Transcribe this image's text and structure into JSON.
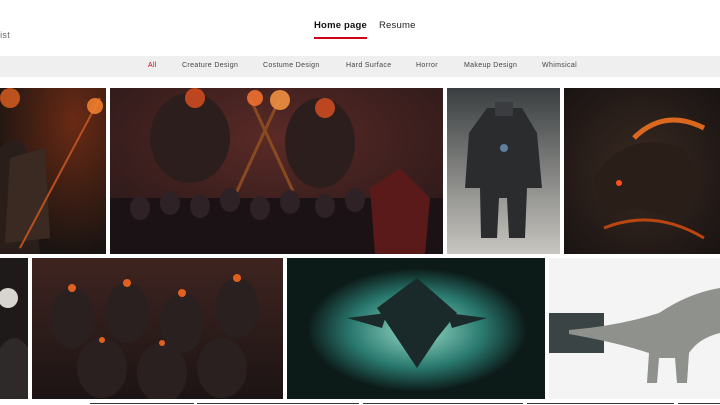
{
  "brand": {
    "subtitle": "rtist"
  },
  "nav": {
    "items": [
      {
        "label": "Home page"
      },
      {
        "label": "Resume"
      }
    ]
  },
  "filters": {
    "items": [
      "All",
      "Creature Design",
      "Costume Design",
      "Hard Surface",
      "Horror",
      "Makeup Design",
      "Whimsical"
    ]
  },
  "colors": {
    "accent": "#d0021b",
    "filter_bg": "#efefef"
  },
  "gallery": {
    "tiles": [
      {
        "subject": "flaming-skull-rider-with-spear"
      },
      {
        "subject": "fire-demons-and-skeleton-army"
      },
      {
        "subject": "armored-mech-hulk"
      },
      {
        "subject": "burning-beast-creature"
      },
      {
        "subject": "cropped-portrait"
      },
      {
        "subject": "horde-of-burning-demons"
      },
      {
        "subject": "winged-creature-in-green-portal"
      },
      {
        "subject": "grey-dinosaur-render"
      }
    ]
  }
}
